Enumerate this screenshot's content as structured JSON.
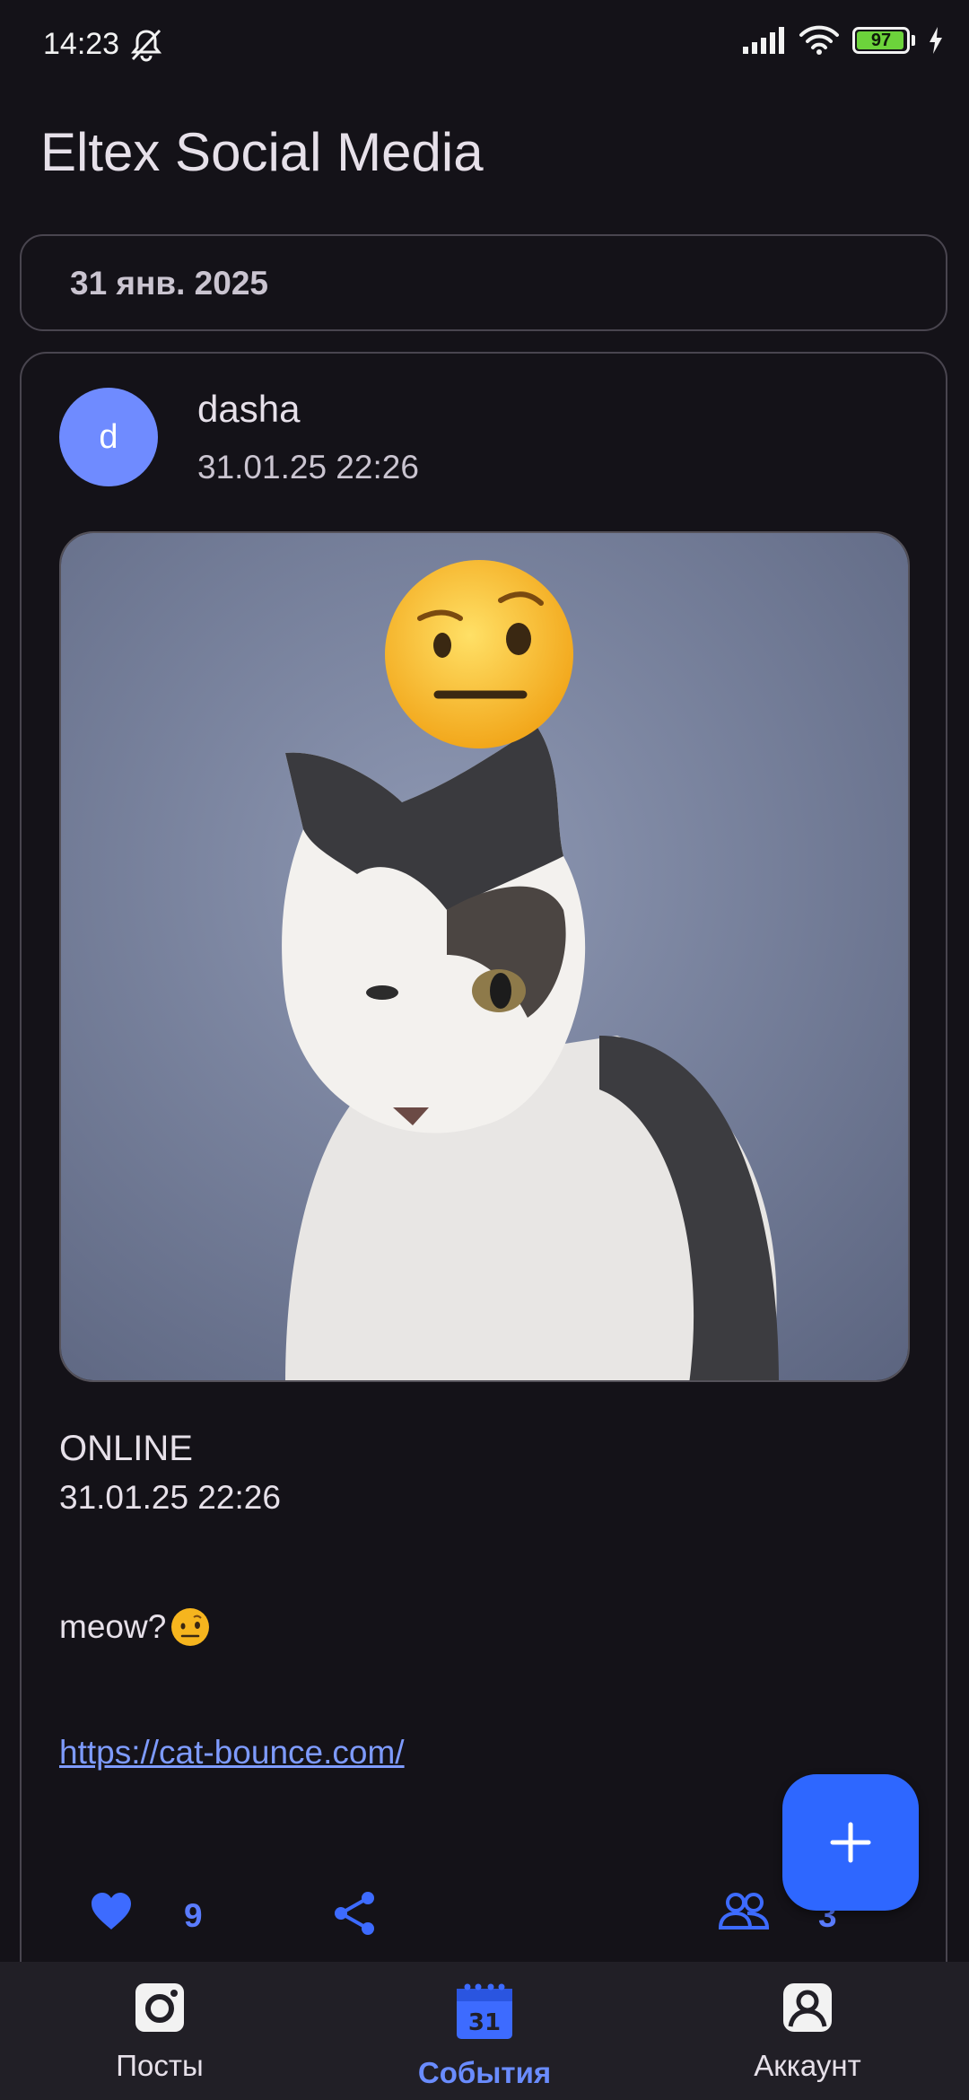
{
  "status_bar": {
    "time": "14:23",
    "battery": "97",
    "battery_level": 0.97
  },
  "app_bar": {
    "title": "Eltex Social Media"
  },
  "date_chip": {
    "label": "31 янв. 2025"
  },
  "post": {
    "avatar_letter": "d",
    "author": "dasha",
    "published": "31.01.25 22:26",
    "event_type": "ONLINE",
    "event_time": "31.01.25 22:26",
    "content": "meow?",
    "content_emoji": "raised-eyebrow-emoji",
    "link": "https://cat-bounce.com/",
    "likes": "9",
    "participants": "3"
  },
  "fab": {
    "icon": "plus-icon"
  },
  "bottom_nav": {
    "items": [
      {
        "label": "Посты",
        "icon": "posts-icon"
      },
      {
        "label": "События",
        "icon": "calendar-icon"
      },
      {
        "label": "Аккаунт",
        "icon": "account-icon"
      }
    ],
    "active": 1
  },
  "colors": {
    "accent": "#2E67FF",
    "link": "#7E9BFF",
    "background": "#141218"
  }
}
